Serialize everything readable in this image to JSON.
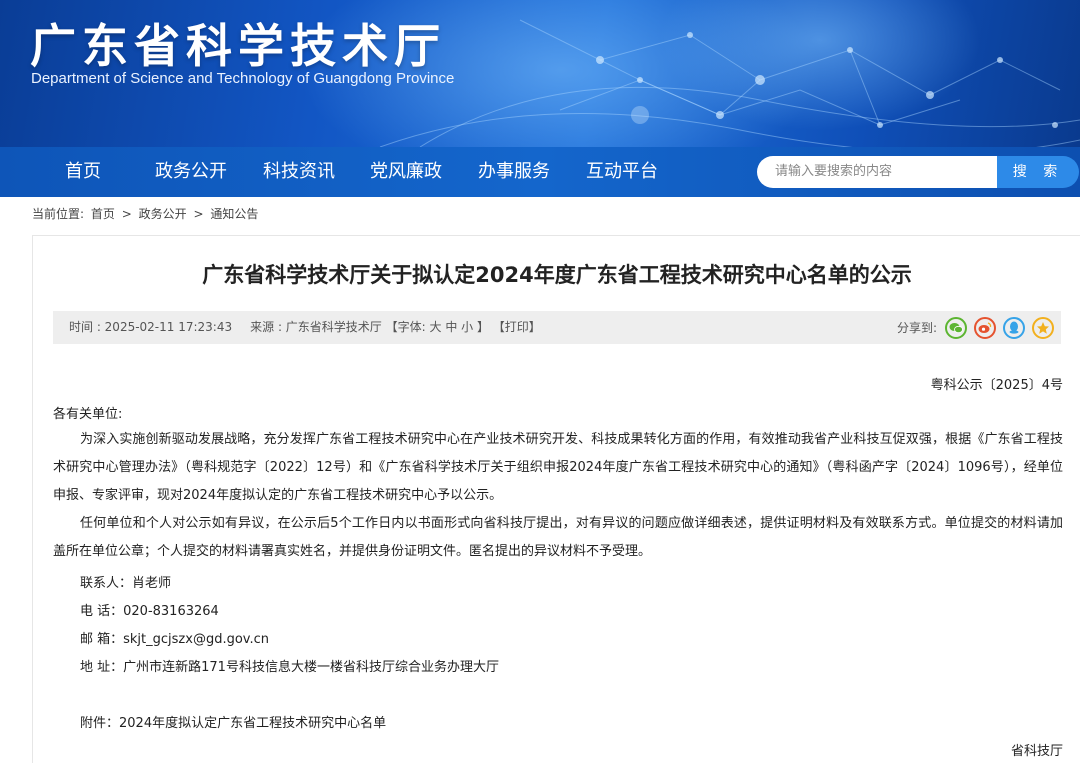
{
  "header": {
    "title": "广东省科学技术厅",
    "subtitle": "Department of Science and Technology of Guangdong Province"
  },
  "nav": {
    "items": [
      "首页",
      "政务公开",
      "科技资讯",
      "党风廉政",
      "办事服务",
      "互动平台"
    ],
    "search_placeholder": "请输入要搜索的内容",
    "search_button": "搜 索"
  },
  "breadcrumb": {
    "prefix": "当前位置:",
    "items": [
      "首页",
      "政务公开",
      "通知公告"
    ],
    "separator": ">"
  },
  "article": {
    "title": "广东省科学技术厅关于拟认定2024年度广东省工程技术研究中心名单的公示",
    "meta": {
      "time": "时间 : 2025-02-11 17:23:43",
      "source": "来源 : 广东省科学技术厅",
      "font_size": "【字体: 大 中 小 】",
      "print": "【打印】",
      "share_label": "分享到:"
    },
    "doc_number": "粤科公示〔2025〕4号",
    "salutation": "各有关单位:",
    "paragraphs": [
      "为深入实施创新驱动发展战略，充分发挥广东省工程技术研究中心在产业技术研究开发、科技成果转化方面的作用，有效推动我省产业科技互促双强，根据《广东省工程技术研究中心管理办法》（粤科规范字〔2022〕12号）和《广东省科学技术厅关于组织申报2024年度广东省工程技术研究中心的通知》（粤科函产字〔2024〕1096号），经单位申报、专家评审，现对2024年度拟认定的广东省工程技术研究中心予以公示。",
      "任何单位和个人对公示如有异议，在公示后5个工作日内以书面形式向省科技厅提出，对有异议的问题应做详细表述，提供证明材料及有效联系方式。单位提交的材料请加盖所在单位公章；个人提交的材料请署真实姓名，并提供身份证明文件。匿名提出的异议材料不予受理。"
    ],
    "contact": {
      "person": "联系人：肖老师",
      "phone": "电  话：020-83163264",
      "email": "邮  箱：skjt_gcjszx@gd.gov.cn",
      "address": "地  址：广州市连新路171号科技信息大楼一楼省科技厅综合业务办理大厅"
    },
    "attachment": "附件：2024年度拟认定广东省工程技术研究中心名单",
    "signature": "省科技厅"
  },
  "colors": {
    "banner_dark": "#0a3d96",
    "nav_blue": "#1466cc",
    "search_button": "#2d8ae8",
    "wechat": "#5cb531",
    "weibo": "#e5532f",
    "qq": "#36a3e8",
    "qzone": "#f2b01e"
  },
  "icons": [
    "wechat-icon",
    "weibo-icon",
    "qq-icon",
    "qzone-icon"
  ]
}
